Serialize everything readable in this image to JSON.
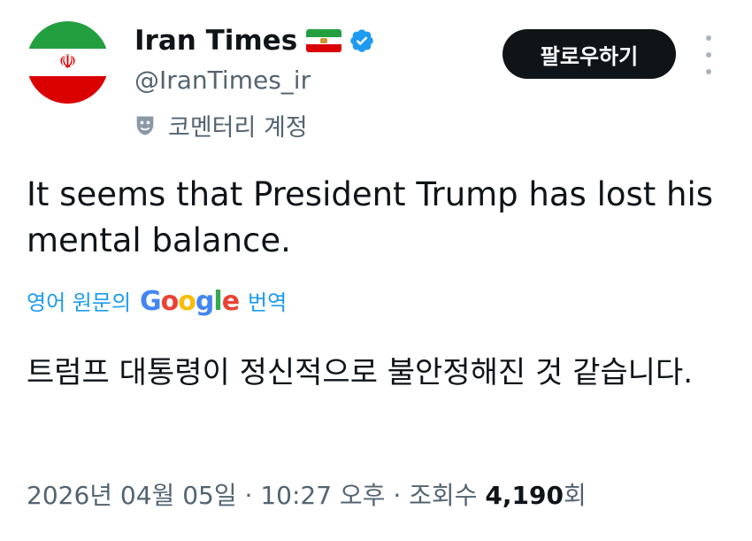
{
  "account": {
    "display_name": "Iran Times",
    "flag_icon": "iran-lion-and-sun-flag",
    "verified_icon": "verified-badge-icon",
    "handle": "@IranTimes_ir",
    "label": "코멘터리 계정",
    "label_icon": "theater-mask-icon"
  },
  "header": {
    "follow_label": "팔로우하기",
    "more_icon": "more-vertical-icon"
  },
  "tweet": {
    "text": "It seems that President Trump has lost his mental balance.",
    "translate_prefix": "영어 원문의",
    "translate_brand": "Google",
    "translate_suffix": "번역",
    "translation": "트럼프 대통령이 정신적으로 불안정해진 것 같습니다."
  },
  "meta": {
    "date": "2026년 04월 05일",
    "time": "10:27 오후",
    "views_label": "조회수",
    "views_count": "4,190",
    "views_unit": "회"
  },
  "colors": {
    "text": "#0f1419",
    "secondary": "#536471",
    "link": "#1d9bf0",
    "button_bg": "#0f1419",
    "verified": "#1d9bf0"
  }
}
